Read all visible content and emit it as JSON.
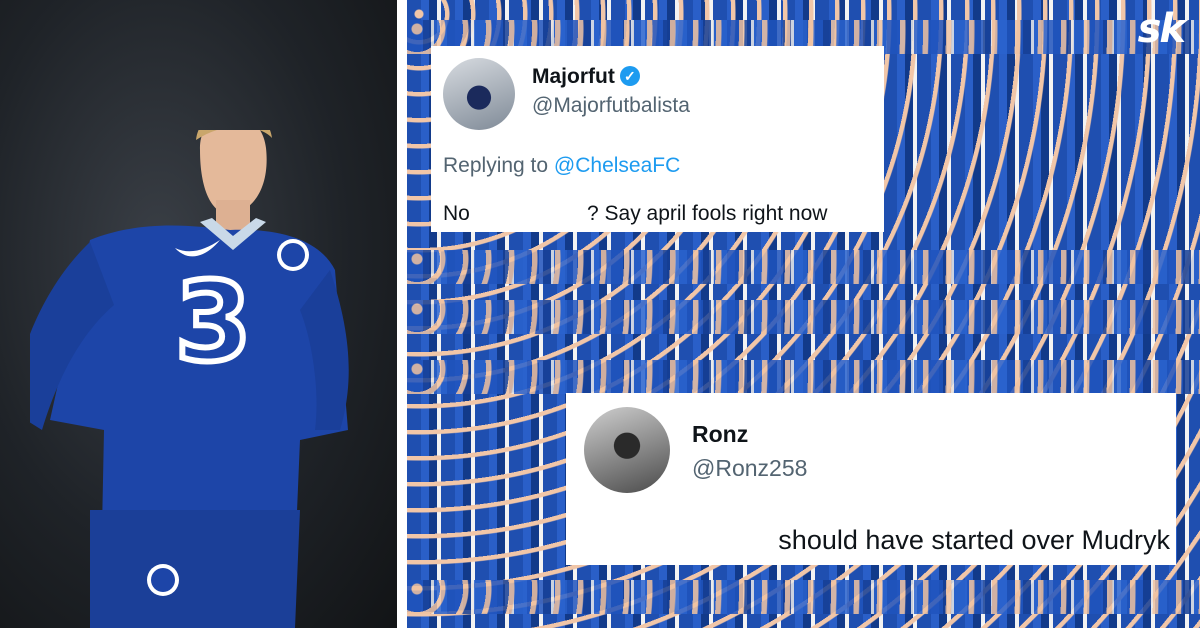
{
  "brand": {
    "logo_text": "sk",
    "color": "#ffffff"
  },
  "tweets": [
    {
      "name": "Majorfut",
      "verified": true,
      "handle": "@Majorfutbalista",
      "reply_prefix": "Replying to",
      "reply_to": "@ChelseaFC",
      "text_start": "No",
      "text_end": "? Say april fools right now"
    },
    {
      "name": "Ronz",
      "verified": false,
      "handle": "@Ronz258",
      "text": "should have started over Mudryk"
    }
  ],
  "colors": {
    "kit_blue": "#1d45a8",
    "link_blue": "#1d9bf0",
    "verified_blue": "#1d9bf0"
  },
  "icons": [
    "verified-badge-icon"
  ]
}
